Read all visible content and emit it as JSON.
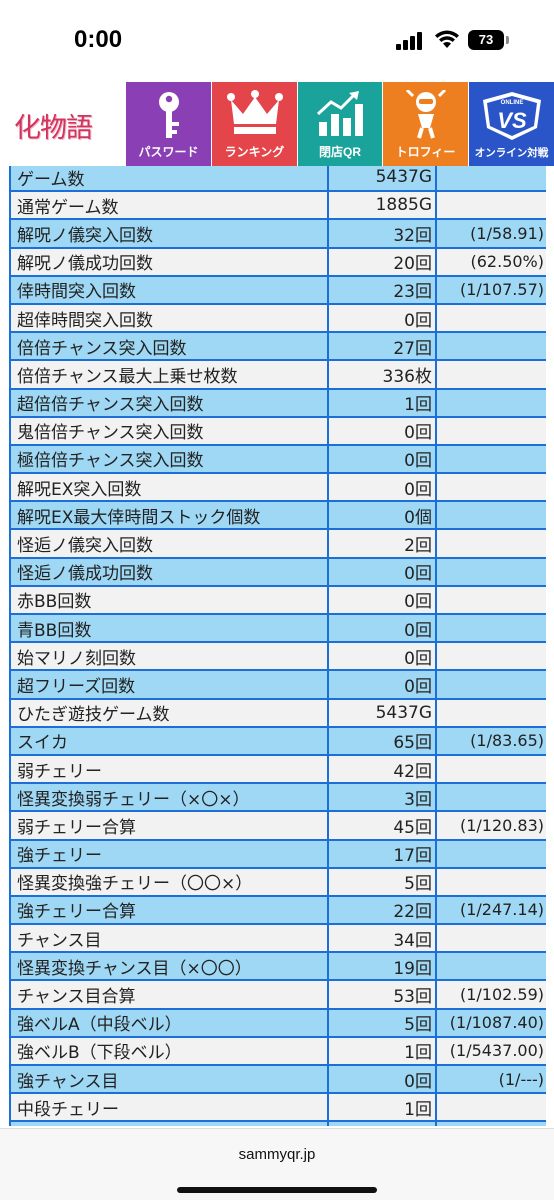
{
  "status_bar": {
    "time": "0:00",
    "battery": "73"
  },
  "nav": {
    "logo_text": "化物語",
    "tabs": [
      {
        "label": "パスワード",
        "icon": "key-icon"
      },
      {
        "label": "ランキング",
        "icon": "crown-icon"
      },
      {
        "label": "閉店QR",
        "icon": "chart-icon"
      },
      {
        "label": "トロフィー",
        "icon": "trophy-figure-icon"
      },
      {
        "label": "オンライン対戦",
        "icon": "versus-icon",
        "badge": "VS",
        "badge_top": "ONLINE"
      }
    ]
  },
  "stats": [
    {
      "name": "ゲーム数",
      "value": "5437G",
      "ratio": ""
    },
    {
      "name": "通常ゲーム数",
      "value": "1885G",
      "ratio": ""
    },
    {
      "name": "解呪ノ儀突入回数",
      "value": "32回",
      "ratio": "(1/58.91)"
    },
    {
      "name": "解呪ノ儀成功回数",
      "value": "20回",
      "ratio": "(62.50%)"
    },
    {
      "name": "倖時間突入回数",
      "value": "23回",
      "ratio": "(1/107.57)"
    },
    {
      "name": "超倖時間突入回数",
      "value": "0回",
      "ratio": ""
    },
    {
      "name": "倍倍チャンス突入回数",
      "value": "27回",
      "ratio": ""
    },
    {
      "name": "倍倍チャンス最大上乗せ枚数",
      "value": "336枚",
      "ratio": ""
    },
    {
      "name": "超倍倍チャンス突入回数",
      "value": "1回",
      "ratio": ""
    },
    {
      "name": "鬼倍倍チャンス突入回数",
      "value": "0回",
      "ratio": ""
    },
    {
      "name": "極倍倍チャンス突入回数",
      "value": "0回",
      "ratio": ""
    },
    {
      "name": "解呪EX突入回数",
      "value": "0回",
      "ratio": ""
    },
    {
      "name": "解呪EX最大倖時間ストック個数",
      "value": "0個",
      "ratio": ""
    },
    {
      "name": "怪逅ノ儀突入回数",
      "value": "2回",
      "ratio": ""
    },
    {
      "name": "怪逅ノ儀成功回数",
      "value": "0回",
      "ratio": ""
    },
    {
      "name": "赤BB回数",
      "value": "0回",
      "ratio": ""
    },
    {
      "name": "青BB回数",
      "value": "0回",
      "ratio": ""
    },
    {
      "name": "始マリノ刻回数",
      "value": "0回",
      "ratio": ""
    },
    {
      "name": "超フリーズ回数",
      "value": "0回",
      "ratio": ""
    },
    {
      "name": "ひたぎ遊技ゲーム数",
      "value": "5437G",
      "ratio": ""
    },
    {
      "name": "スイカ",
      "value": "65回",
      "ratio": "(1/83.65)"
    },
    {
      "name": "弱チェリー",
      "value": "42回",
      "ratio": ""
    },
    {
      "name": "怪異変換弱チェリー（×〇×）",
      "value": "3回",
      "ratio": ""
    },
    {
      "name": "弱チェリー合算",
      "value": "45回",
      "ratio": "(1/120.83)"
    },
    {
      "name": "強チェリー",
      "value": "17回",
      "ratio": ""
    },
    {
      "name": "怪異変換強チェリー（〇〇×）",
      "value": "5回",
      "ratio": ""
    },
    {
      "name": "強チェリー合算",
      "value": "22回",
      "ratio": "(1/247.14)"
    },
    {
      "name": "チャンス目",
      "value": "34回",
      "ratio": ""
    },
    {
      "name": "怪異変換チャンス目（×〇〇）",
      "value": "19回",
      "ratio": ""
    },
    {
      "name": "チャンス目合算",
      "value": "53回",
      "ratio": "(1/102.59)"
    },
    {
      "name": "強ベルA（中段ベル）",
      "value": "5回",
      "ratio": "(1/1087.40)"
    },
    {
      "name": "強ベルB（下段ベル）",
      "value": "1回",
      "ratio": "(1/5437.00)"
    },
    {
      "name": "強チャンス目",
      "value": "0回",
      "ratio": "(1/---)"
    },
    {
      "name": "中段チェリー",
      "value": "1回",
      "ratio": ""
    },
    {
      "name": "",
      "value": "",
      "ratio": ""
    }
  ],
  "browser": {
    "url": "sammyqr.jp"
  },
  "colors": {
    "row_blue": "#9fd8f5",
    "row_gray": "#f2f2f2",
    "border_blue": "#1c6fd6"
  }
}
